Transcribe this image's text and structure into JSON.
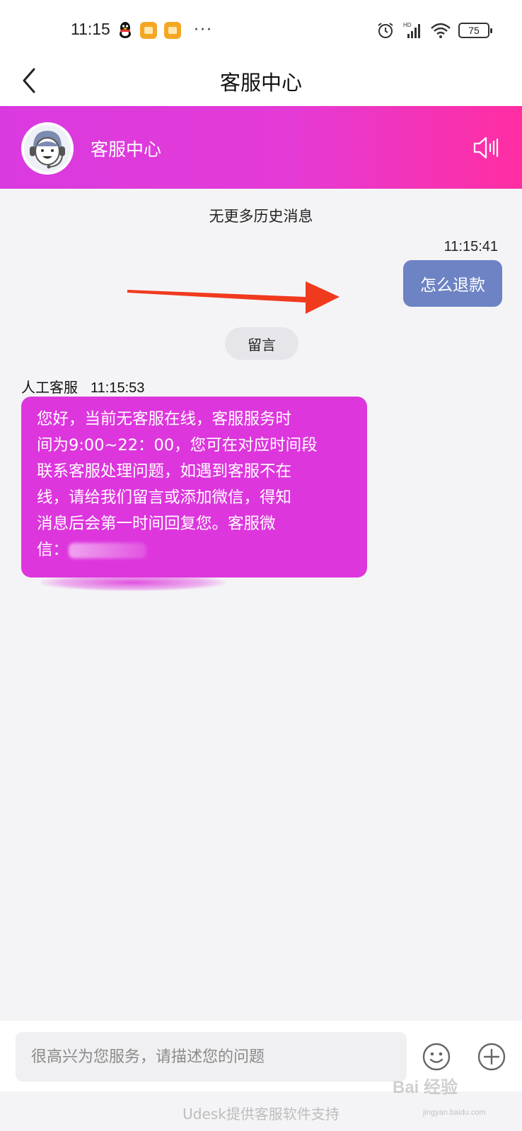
{
  "status_bar": {
    "time": "11:15",
    "battery": "75",
    "signal_tag": "HD",
    "more": "···"
  },
  "nav": {
    "title": "客服中心"
  },
  "header": {
    "agent_name": "客服中心"
  },
  "chat": {
    "history_note": "无更多历史消息",
    "outgoing": {
      "time": "11:15:41",
      "text": "怎么退款"
    },
    "leave_message_label": "留言",
    "incoming": {
      "sender": "人工客服",
      "time": "11:15:53",
      "lines": [
        "您好，当前无客服在线，客服服务时",
        "间为9:00~22：00，您可在对应时间段",
        "联系客服处理问题，如遇到客服不在",
        "线，请给我们留言或添加微信，得知",
        "消息后会第一时间回复您。客服微",
        "信："
      ]
    }
  },
  "composer": {
    "placeholder": "很高兴为您服务，请描述您的问题"
  },
  "footer": {
    "powered_by": "Udesk提供客服软件支持",
    "watermark": "Bai 经验",
    "watermark_url": "jingyan.baidu.com"
  },
  "colors": {
    "header_gradient_start": "#d93ae0",
    "header_gradient_end": "#ff2ea1",
    "outgoing_bubble": "#6d83c4",
    "incoming_bubble": "#dd36dd",
    "annotation_arrow": "#f03a1e"
  }
}
